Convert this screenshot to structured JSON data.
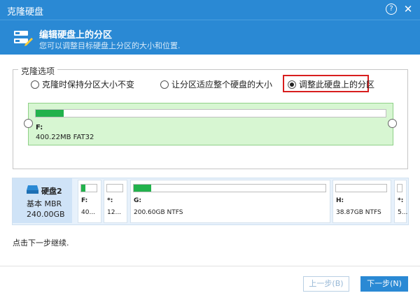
{
  "window": {
    "title": "克隆硬盘",
    "help": "?",
    "close": "✕"
  },
  "header": {
    "title": "编辑硬盘上的分区",
    "subtitle": "您可以调整目标硬盘上分区的大小和位置."
  },
  "options": {
    "group_title": "克隆选项",
    "items": [
      {
        "label": "克隆时保持分区大小不变",
        "selected": false
      },
      {
        "label": "让分区适应整个硬盘的大小",
        "selected": false
      },
      {
        "label": "调整此硬盘上的分区",
        "selected": true
      }
    ]
  },
  "partition_edit": {
    "label": "F:",
    "size": "400.22MB FAT32",
    "used_fraction": 0.08
  },
  "disk": {
    "name": "硬盘2",
    "type": "基本 MBR",
    "size": "240.00GB",
    "partitions": [
      {
        "label": "F:",
        "size": "40...",
        "used_fraction": 0.25
      },
      {
        "label": "*:",
        "size": "12...",
        "used_fraction": 0.0
      },
      {
        "label": "G:",
        "size": "200.60GB NTFS",
        "used_fraction": 0.09
      },
      {
        "label": "H:",
        "size": "38.87GB NTFS",
        "used_fraction": 0.0
      },
      {
        "label": "*:",
        "size": "5...",
        "used_fraction": 0.0
      }
    ]
  },
  "hint": "点击下一步继续.",
  "buttons": {
    "prev": "上一步(B)",
    "next": "下一步(N)"
  },
  "colors": {
    "accent": "#2a89d4",
    "partition_bg": "#d7f6d2",
    "used": "#22b24c",
    "highlight": "#d81e1e"
  }
}
